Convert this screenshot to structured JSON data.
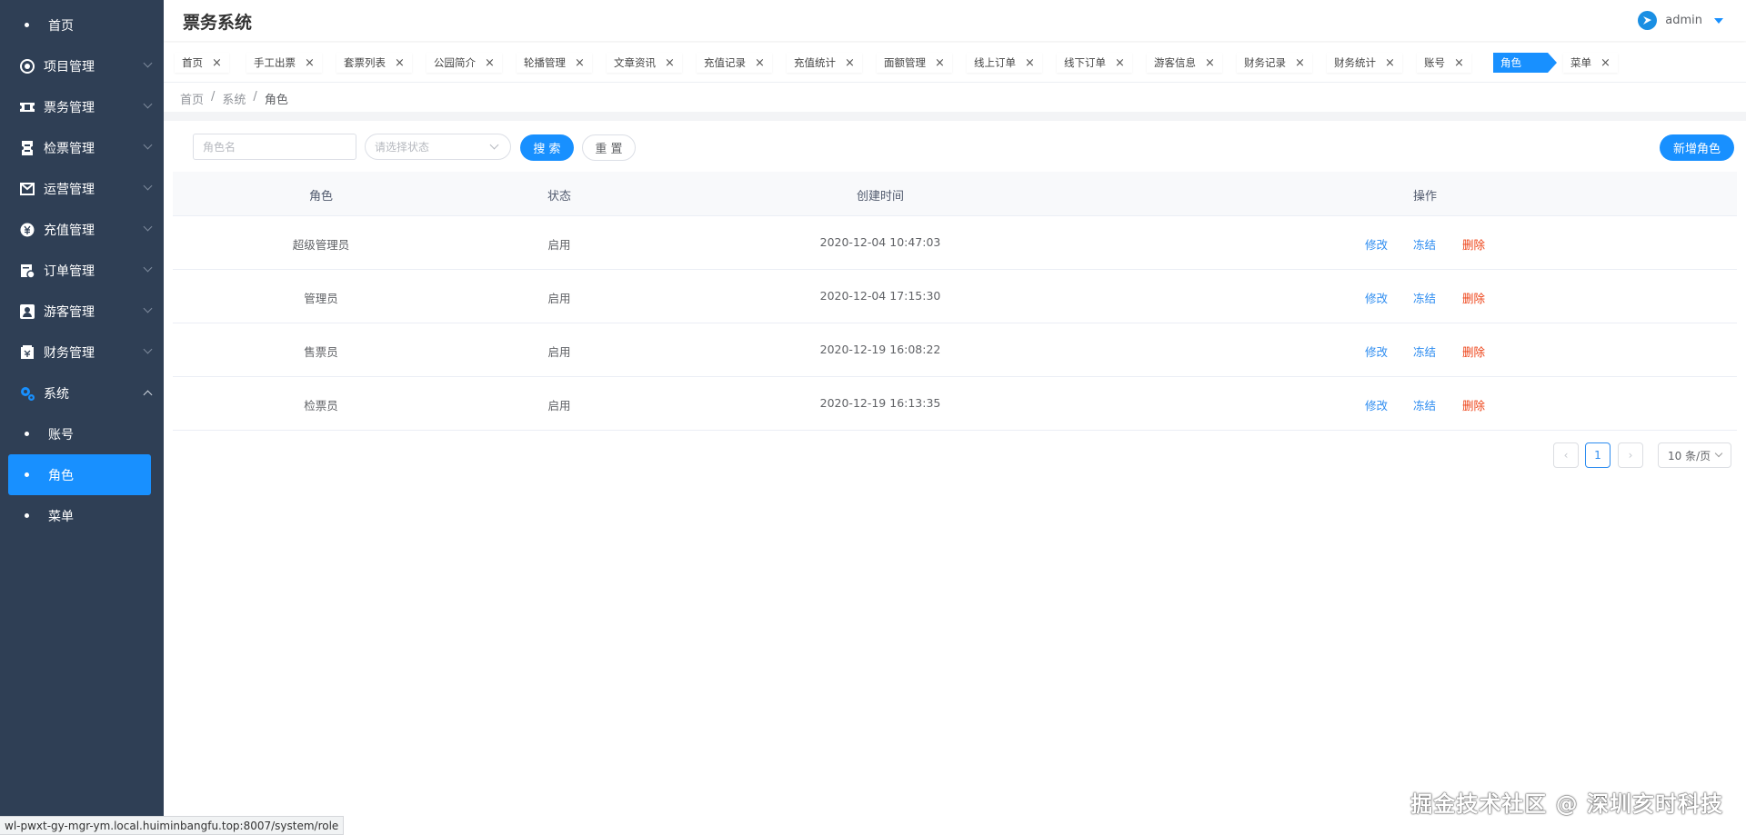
{
  "app_title": "票务系统",
  "user": {
    "name": "admin"
  },
  "sidebar": {
    "items": [
      {
        "label": "首页",
        "icon": "dot"
      },
      {
        "label": "项目管理",
        "icon": "target-icon"
      },
      {
        "label": "票务管理",
        "icon": "ticket-icon"
      },
      {
        "label": "检票管理",
        "icon": "check-ticket-icon"
      },
      {
        "label": "运营管理",
        "icon": "operation-icon"
      },
      {
        "label": "充值管理",
        "icon": "coin-icon"
      },
      {
        "label": "订单管理",
        "icon": "order-icon"
      },
      {
        "label": "游客管理",
        "icon": "user-icon"
      },
      {
        "label": "财务管理",
        "icon": "finance-icon"
      },
      {
        "label": "系统",
        "icon": "gear-icon"
      }
    ],
    "sub_items": [
      {
        "label": "账号"
      },
      {
        "label": "角色",
        "active": true
      },
      {
        "label": "菜单"
      }
    ]
  },
  "tags": [
    "首页",
    "手工出票",
    "套票列表",
    "公园简介",
    "轮播管理",
    "文章资讯",
    "充值记录",
    "充值统计",
    "面额管理",
    "线上订单",
    "线下订单",
    "游客信息",
    "财务记录",
    "财务统计",
    "账号",
    "角色",
    "菜单"
  ],
  "active_tag": "角色",
  "breadcrumb": {
    "home": "首页",
    "parent": "系统",
    "current": "角色"
  },
  "filters": {
    "role_placeholder": "角色名",
    "status_placeholder": "请选择状态",
    "search_label": "搜 索",
    "reset_label": "重 置",
    "add_label": "新增角色"
  },
  "table": {
    "headers": {
      "role": "角色",
      "status": "状态",
      "created": "创建时间",
      "actions": "操作"
    },
    "rows": [
      {
        "role": "超级管理员",
        "status": "启用",
        "created": "2020-12-04 10:47:03"
      },
      {
        "role": "管理员",
        "status": "启用",
        "created": "2020-12-04 17:15:30"
      },
      {
        "role": "售票员",
        "status": "启用",
        "created": "2020-12-19 16:08:22"
      },
      {
        "role": "检票员",
        "status": "启用",
        "created": "2020-12-19 16:13:35"
      }
    ],
    "actions": {
      "edit": "修改",
      "freeze": "冻结",
      "delete": "删除"
    }
  },
  "pagination": {
    "current_page": "1",
    "page_size": "10 条/页"
  },
  "status_url": "wl-pwxt-gy-mgr-ym.local.huiminbangfu.top:8007/system/role",
  "watermark": "掘金技术社区 @ 深圳亥时科技",
  "colors": {
    "sidebar_bg": "#2f3f55",
    "accent": "#1890ff",
    "link": "#2d8cf0",
    "danger": "#ed4014"
  }
}
